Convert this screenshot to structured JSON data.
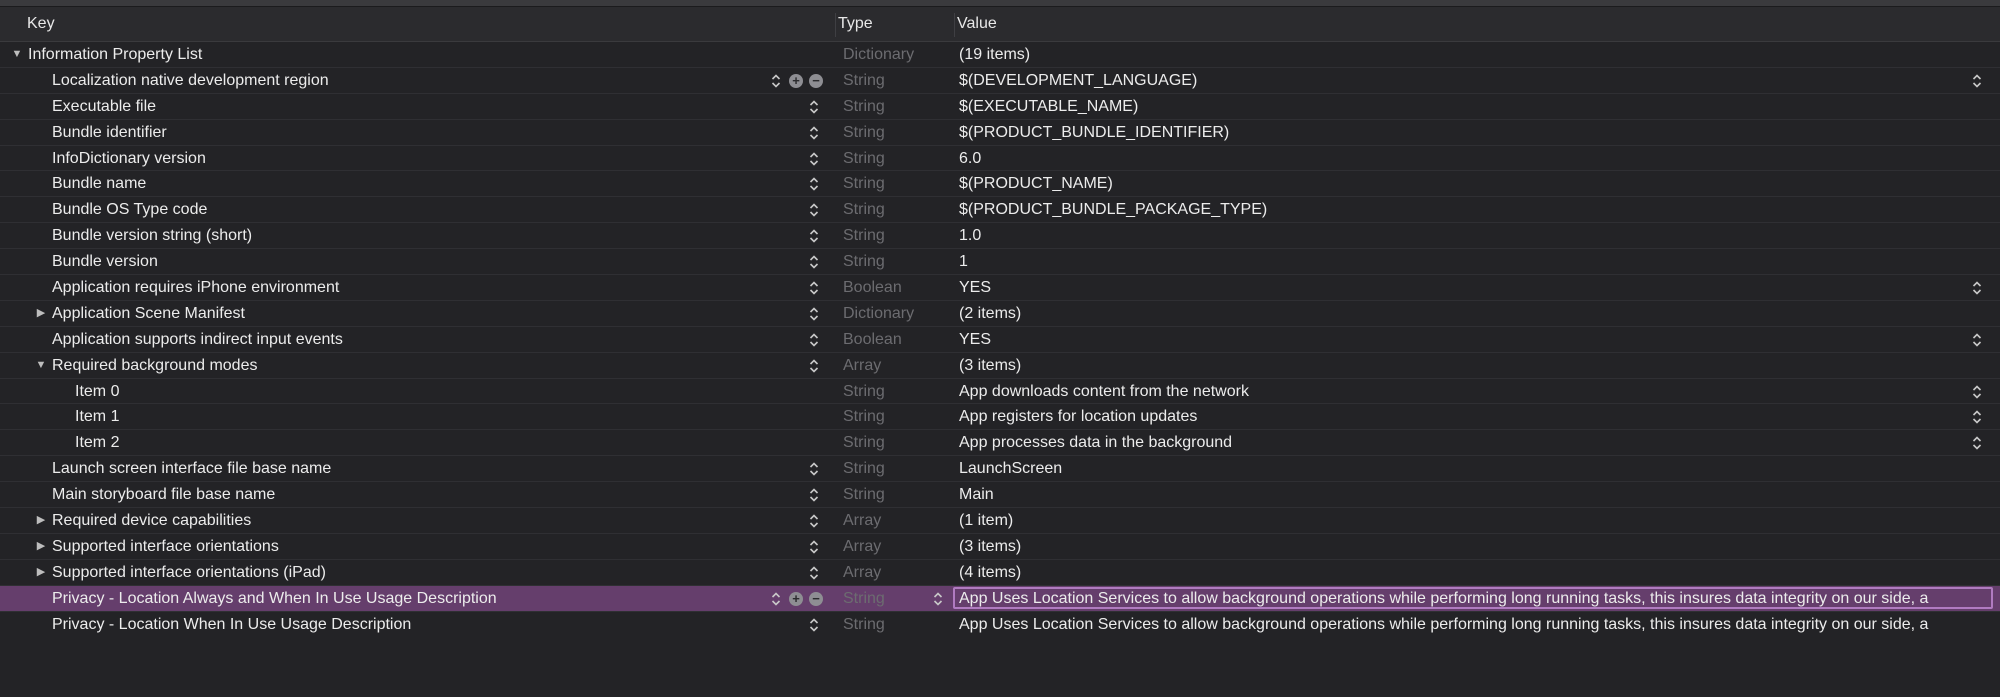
{
  "header": {
    "key": "Key",
    "type": "Type",
    "value": "Value"
  },
  "rows": [
    {
      "key": "Information Property List",
      "type": "Dictionary",
      "value": "(19 items)",
      "indent": 0,
      "disclosure": "open",
      "stepper": false,
      "valStepper": false,
      "controls": false
    },
    {
      "key": "Localization native development region",
      "type": "String",
      "value": "$(DEVELOPMENT_LANGUAGE)",
      "indent": 1,
      "disclosure": "",
      "stepper": true,
      "valStepper": true,
      "controls": true
    },
    {
      "key": "Executable file",
      "type": "String",
      "value": "$(EXECUTABLE_NAME)",
      "indent": 1,
      "disclosure": "",
      "stepper": true,
      "valStepper": false,
      "controls": false
    },
    {
      "key": "Bundle identifier",
      "type": "String",
      "value": "$(PRODUCT_BUNDLE_IDENTIFIER)",
      "indent": 1,
      "disclosure": "",
      "stepper": true,
      "valStepper": false,
      "controls": false
    },
    {
      "key": "InfoDictionary version",
      "type": "String",
      "value": "6.0",
      "indent": 1,
      "disclosure": "",
      "stepper": true,
      "valStepper": false,
      "controls": false
    },
    {
      "key": "Bundle name",
      "type": "String",
      "value": "$(PRODUCT_NAME)",
      "indent": 1,
      "disclosure": "",
      "stepper": true,
      "valStepper": false,
      "controls": false
    },
    {
      "key": "Bundle OS Type code",
      "type": "String",
      "value": "$(PRODUCT_BUNDLE_PACKAGE_TYPE)",
      "indent": 1,
      "disclosure": "",
      "stepper": true,
      "valStepper": false,
      "controls": false
    },
    {
      "key": "Bundle version string (short)",
      "type": "String",
      "value": "1.0",
      "indent": 1,
      "disclosure": "",
      "stepper": true,
      "valStepper": false,
      "controls": false
    },
    {
      "key": "Bundle version",
      "type": "String",
      "value": "1",
      "indent": 1,
      "disclosure": "",
      "stepper": true,
      "valStepper": false,
      "controls": false
    },
    {
      "key": "Application requires iPhone environment",
      "type": "Boolean",
      "value": "YES",
      "indent": 1,
      "disclosure": "",
      "stepper": true,
      "valStepper": true,
      "controls": false
    },
    {
      "key": "Application Scene Manifest",
      "type": "Dictionary",
      "value": "(2 items)",
      "indent": 1,
      "disclosure": "closed",
      "stepper": true,
      "valStepper": false,
      "controls": false
    },
    {
      "key": "Application supports indirect input events",
      "type": "Boolean",
      "value": "YES",
      "indent": 1,
      "disclosure": "",
      "stepper": true,
      "valStepper": true,
      "controls": false
    },
    {
      "key": "Required background modes",
      "type": "Array",
      "value": "(3 items)",
      "indent": 1,
      "disclosure": "open",
      "stepper": true,
      "valStepper": false,
      "controls": false
    },
    {
      "key": "Item 0",
      "type": "String",
      "value": "App downloads content from the network",
      "indent": 2,
      "disclosure": "",
      "stepper": false,
      "valStepper": true,
      "controls": false
    },
    {
      "key": "Item 1",
      "type": "String",
      "value": "App registers for location updates",
      "indent": 2,
      "disclosure": "",
      "stepper": false,
      "valStepper": true,
      "controls": false
    },
    {
      "key": "Item 2",
      "type": "String",
      "value": "App processes data in the background",
      "indent": 2,
      "disclosure": "",
      "stepper": false,
      "valStepper": true,
      "controls": false
    },
    {
      "key": "Launch screen interface file base name",
      "type": "String",
      "value": "LaunchScreen",
      "indent": 1,
      "disclosure": "",
      "stepper": true,
      "valStepper": false,
      "controls": false
    },
    {
      "key": "Main storyboard file base name",
      "type": "String",
      "value": "Main",
      "indent": 1,
      "disclosure": "",
      "stepper": true,
      "valStepper": false,
      "controls": false
    },
    {
      "key": "Required device capabilities",
      "type": "Array",
      "value": "(1 item)",
      "indent": 1,
      "disclosure": "closed",
      "stepper": true,
      "valStepper": false,
      "controls": false
    },
    {
      "key": "Supported interface orientations",
      "type": "Array",
      "value": "(3 items)",
      "indent": 1,
      "disclosure": "closed",
      "stepper": true,
      "valStepper": false,
      "controls": false
    },
    {
      "key": "Supported interface orientations (iPad)",
      "type": "Array",
      "value": "(4 items)",
      "indent": 1,
      "disclosure": "closed",
      "stepper": true,
      "valStepper": false,
      "controls": false
    },
    {
      "key": "Privacy - Location Always and When In Use Usage Description",
      "type": "String",
      "value": "App Uses Location Services to allow background operations while performing long running tasks, this insures data integrity on our side, a",
      "indent": 1,
      "disclosure": "",
      "stepper": true,
      "valStepper": false,
      "controls": true,
      "selected": true
    },
    {
      "key": "Privacy - Location When In Use Usage Description",
      "type": "String",
      "value": "App Uses Location Services to allow background operations while performing long running tasks, this insures data integrity on our side, a",
      "indent": 1,
      "disclosure": "",
      "stepper": true,
      "valStepper": false,
      "controls": false
    }
  ],
  "icons": {
    "open": "disclosure-triangle-open-icon",
    "closed": "disclosure-triangle-closed-icon",
    "stepper": "up-down-stepper-icon",
    "add": "add-circle-icon",
    "remove": "remove-circle-icon"
  },
  "colors": {
    "selection": "#653e6c",
    "selection_border": "#b07bc0",
    "background": "#232326"
  }
}
